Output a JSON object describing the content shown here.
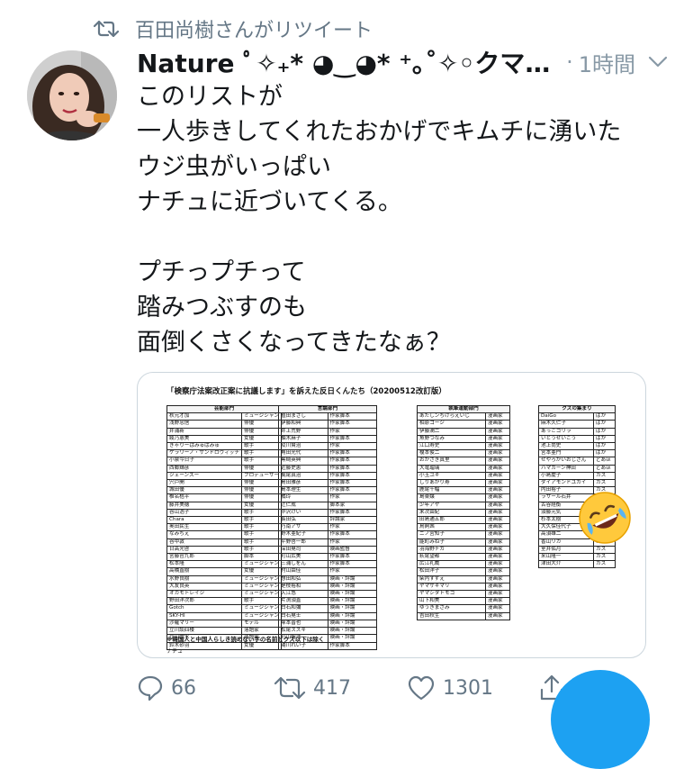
{
  "retweet_header": {
    "text": "百田尚樹さんがリツイート"
  },
  "tweet": {
    "display_name": "Nature ﾟ✧₊* ◕‿◕* ⁺｡˚✧◦クマ…",
    "separator": "·",
    "time": "1時間",
    "lines": [
      "このリストが",
      "一人歩きしてくれたおかげでキムチに湧いた",
      "ウジ虫がいっぱい",
      "ナチュに近づいてくる。",
      "",
      "プチっプチって",
      "踏みつぶすのも",
      "面倒くさくなってきたなぁ？"
    ]
  },
  "card_image": {
    "title": "「検察庁法案改正案に抗議します」を訴えた反日くんたち（20200512改訂版）",
    "tables": [
      {
        "header": "芸能部門",
        "rows": [
          [
            "秋元才加",
            "ミュージシャン"
          ],
          [
            "浅野忠信",
            "俳優"
          ],
          [
            "井浦新",
            "俳優"
          ],
          [
            "綾乃恵美",
            "女優"
          ],
          [
            "きゃりーぱみゅぱみゅ",
            "歌手"
          ],
          [
            "ケラリーノ・サンドロヴィッチ",
            "歌手"
          ],
          [
            "小泉今日子",
            "歌手"
          ],
          [
            "西郷輝彦",
            "俳優"
          ],
          [
            "ジェーンスー",
            "プロデューサー"
          ],
          [
            "宍戸開",
            "俳優"
          ],
          [
            "城田優",
            "俳優"
          ],
          [
            "椎名桔平",
            "俳優"
          ],
          [
            "藤井美穂",
            "女優"
          ],
          [
            "谷山浩子",
            "歌手"
          ],
          [
            "Chara",
            "歌手"
          ],
          [
            "奥田民生",
            "歌手"
          ],
          [
            "なみちえ",
            "歌手"
          ],
          [
            "谷中敦",
            "歌手"
          ],
          [
            "日高光啓",
            "歌手"
          ],
          [
            "宮藤官九郎",
            "脚本"
          ],
          [
            "松本隆",
            "ミュージシャン"
          ],
          [
            "高橋直樹",
            "女優"
          ],
          [
            "水野良樹",
            "ミュージシャン"
          ],
          [
            "大友良英",
            "ミュージシャン"
          ],
          [
            "オカモトレイジ",
            "ミュージシャン"
          ],
          [
            "野田洋次郎",
            "歌手"
          ],
          [
            "Gotch",
            "ミュージシャン"
          ],
          [
            "SKY-HI",
            "ミュージシャン"
          ],
          [
            "沙羅マリー",
            "モデル"
          ],
          [
            "立川談四楼",
            "落語家"
          ],
          [
            "立川雲水",
            "落語家"
          ],
          [
            "鈴木砂羽",
            "女優"
          ]
        ]
      },
      {
        "header": "言論部門",
        "rows": [
          [
            "植田まさし",
            "作家脚本"
          ],
          [
            "伊藤和典",
            "作家脚本"
          ],
          [
            "井上荒野",
            "作家"
          ],
          [
            "柚木麻子",
            "作家脚本"
          ],
          [
            "及川賢治",
            "作家"
          ],
          [
            "角田光代",
            "作家脚本"
          ],
          [
            "黒崎英典",
            "作家脚本"
          ],
          [
            "近藤史恵",
            "作家脚本"
          ],
          [
            "梶尾真治",
            "作家脚本"
          ],
          [
            "島田雅彦",
            "作家脚本"
          ],
          [
            "島本理生",
            "作家脚本"
          ],
          [
            "橘玲",
            "作家"
          ],
          [
            "辻仁成",
            "脚本家"
          ],
          [
            "中沢けい",
            "作家脚本"
          ],
          [
            "長田弘",
            "評論家"
          ],
          [
            "乃南アサ",
            "作家"
          ],
          [
            "野木亜紀子",
            "作家脚本"
          ],
          [
            "平野啓一郎",
            "作家"
          ],
          [
            "深田晃司",
            "映画監督"
          ],
          [
            "町山広美",
            "作家脚本"
          ],
          [
            "三浦しをん",
            "作家脚本"
          ],
          [
            "村山由佳",
            "作家"
          ],
          [
            "想田和弘",
            "映画・評論"
          ],
          [
            "是枝裕和",
            "映画・評論"
          ],
          [
            "入江悠",
            "映画・評論"
          ],
          [
            "片渕須直",
            "映画・評論"
          ],
          [
            "白石和彌",
            "映画・評論"
          ],
          [
            "白石晃士",
            "映画・評論"
          ],
          [
            "塚本晋也",
            "映画・評論"
          ],
          [
            "松尾スズキ",
            "映画・評論"
          ],
          [
            "町山智浩",
            "映画・評論"
          ],
          [
            "湯川れい子",
            "作家脚本"
          ]
        ]
      },
      {
        "header": "執筆運動部門",
        "rows": [
          [
            "あたしンちけらえいじ",
            "漫画家"
          ],
          [
            "相原コージ",
            "漫画家"
          ],
          [
            "伊藤潤二",
            "漫画家"
          ],
          [
            "魚野つなみ",
            "漫画家"
          ],
          [
            "江口寿史",
            "漫画家"
          ],
          [
            "榎本俊二",
            "漫画家"
          ],
          [
            "おかざき真里",
            "漫画家"
          ],
          [
            "大竜瑠璃",
            "漫画家"
          ],
          [
            "小玉ユキ",
            "漫画家"
          ],
          [
            "しりあがり寿",
            "漫画家"
          ],
          [
            "鹿尾千幅",
            "漫画家"
          ],
          [
            "島楽嬢",
            "漫画家"
          ],
          [
            "少年アヤ",
            "漫画家"
          ],
          [
            "末次由紀",
            "漫画家"
          ],
          [
            "田島通五郎",
            "漫画家"
          ],
          [
            "鳥飼茜",
            "漫画家"
          ],
          [
            "ニノ宮知子",
            "漫画家"
          ],
          [
            "能町みね子",
            "漫画家"
          ],
          [
            "羽海野チカ",
            "漫画家"
          ],
          [
            "萩尾望都",
            "漫画家"
          ],
          [
            "広江礼威",
            "漫画家"
          ],
          [
            "松田洋子",
            "漫画家"
          ],
          [
            "柴内すずえ",
            "漫画家"
          ],
          [
            "ヤマザキマリ",
            "漫画家"
          ],
          [
            "ヤマシタトモコ",
            "漫画家"
          ],
          [
            "山下和美",
            "漫画家"
          ],
          [
            "ゆうきまさみ",
            "漫画家"
          ],
          [
            "吉田秋生",
            "漫画家"
          ]
        ]
      },
      {
        "header": "クズの集まり",
        "rows": [
          [
            "DaiGo",
            "ばか"
          ],
          [
            "麻木久仁子",
            "ばか"
          ],
          [
            "あっこゴリラ",
            "ばか"
          ],
          [
            "いとうせいこう",
            "ばか"
          ],
          [
            "池上尚史",
            "ばか"
          ],
          [
            "宮本亜門",
            "ばか"
          ],
          [
            "せやろがいおじさん",
            "どあほ"
          ],
          [
            "ハマカーン神田",
            "どあほ"
          ],
          [
            "小島慶子",
            "カス"
          ],
          [
            "ダイアモンドユカイ",
            "カス"
          ],
          [
            "内田裕子",
            "カス"
          ],
          [
            "ラサール石井",
            "カス"
          ],
          [
            "古谷経衡",
            "カス"
          ],
          [
            "須藤元気",
            "カス"
          ],
          [
            "杉本太樹",
            "カス"
          ],
          [
            "大久保佳代子",
            "カス"
          ],
          [
            "高須雄二",
            "カス"
          ],
          [
            "香山リカ",
            "カス"
          ],
          [
            "室井佑月",
            "カス"
          ],
          [
            "米山隆一",
            "カス"
          ],
          [
            "津田大介",
            "カス"
          ]
        ]
      }
    ],
    "note": "※韓国人と中国人らしき読めない字の名前とクズ以下は除く",
    "signature": "ナチュ",
    "emoji": "rolling-on-the-floor-laughing"
  },
  "actions": {
    "reply_count": "66",
    "retweet_count": "417",
    "like_count": "1301"
  },
  "colors": {
    "secondary_text": "#657786",
    "border": "#ccd6dd",
    "accent": "#1da1f2"
  }
}
